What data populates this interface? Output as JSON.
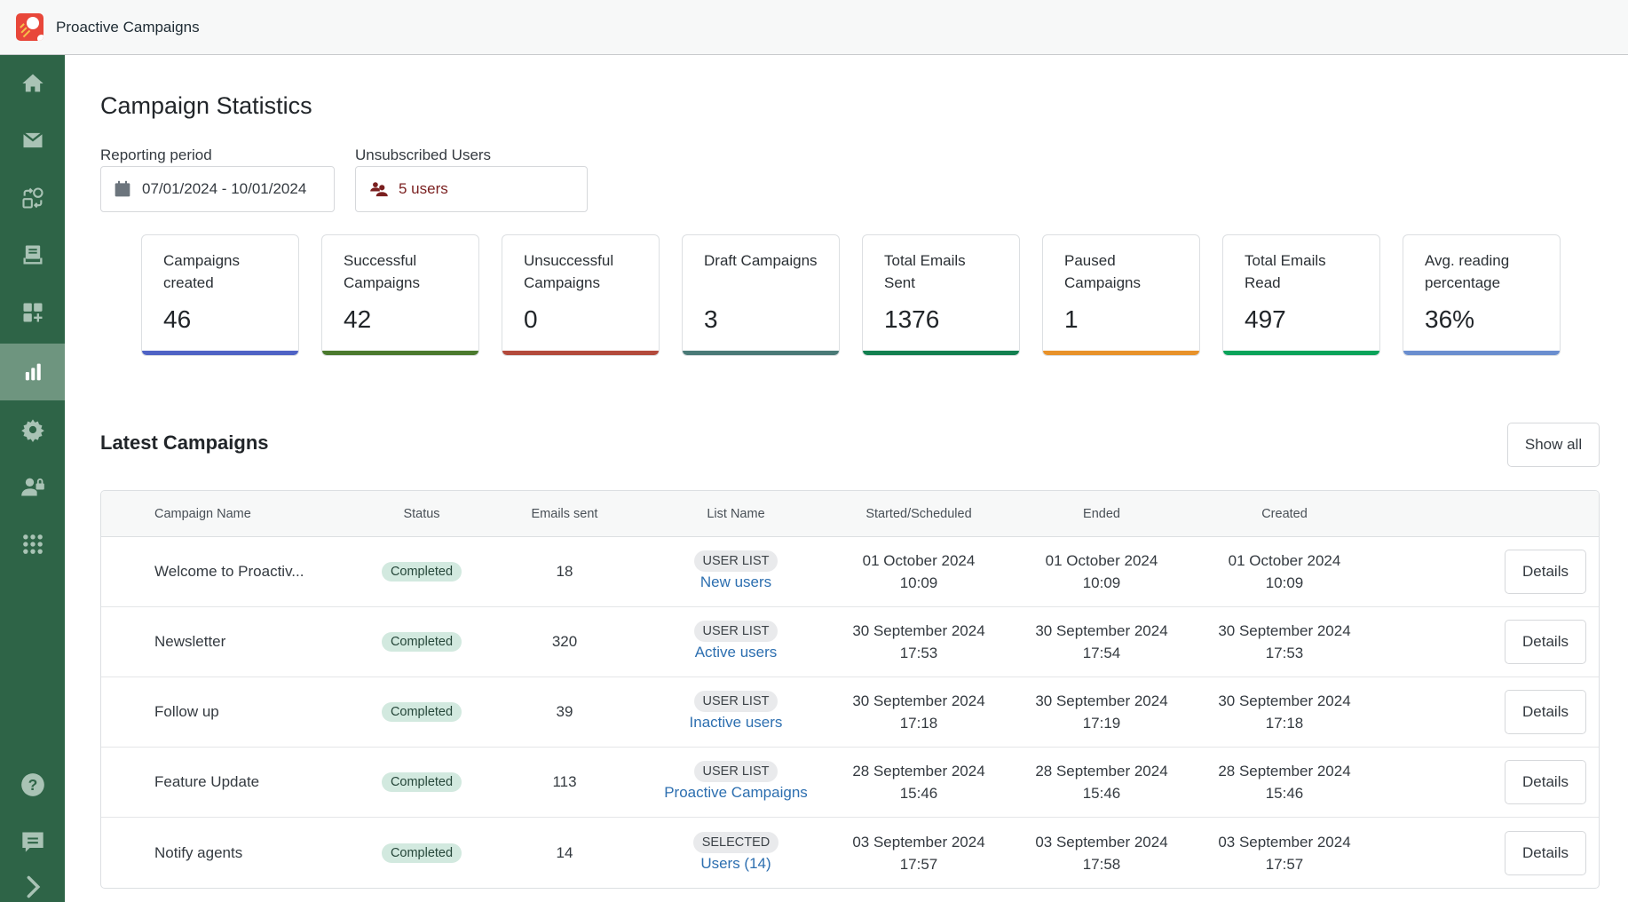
{
  "app": {
    "title": "Proactive Campaigns"
  },
  "sidebar": {
    "items": [
      {
        "name": "home",
        "icon": "home-icon",
        "active": false
      },
      {
        "name": "email",
        "icon": "envelope-icon",
        "active": false
      },
      {
        "name": "automations",
        "icon": "workflow-icon",
        "active": false
      },
      {
        "name": "templates",
        "icon": "inbox-icon",
        "active": false
      },
      {
        "name": "widgets",
        "icon": "add-widget-icon",
        "active": false
      },
      {
        "name": "statistics",
        "icon": "bar-chart-icon",
        "active": true
      },
      {
        "name": "settings",
        "icon": "gear-icon",
        "active": false
      },
      {
        "name": "permissions",
        "icon": "user-lock-icon",
        "active": false
      },
      {
        "name": "apps",
        "icon": "grid-icon",
        "active": false
      }
    ],
    "bottom": [
      {
        "name": "help",
        "icon": "help-icon"
      },
      {
        "name": "feedback",
        "icon": "chat-icon"
      },
      {
        "name": "expand",
        "icon": "chevron-right-icon"
      }
    ]
  },
  "page": {
    "title": "Campaign Statistics"
  },
  "filters": {
    "reporting_period": {
      "label": "Reporting period",
      "value": "07/01/2024 - 10/01/2024"
    },
    "unsubscribed": {
      "label": "Unsubscribed Users",
      "value": "5 users"
    }
  },
  "stats": [
    {
      "label": "Campaigns created",
      "value": "46",
      "color": "#4f63c5"
    },
    {
      "label": "Successful Campaigns",
      "value": "42",
      "color": "#4b7a2e"
    },
    {
      "label": "Unsuccessful Campaigns",
      "value": "0",
      "color": "#b34a3c"
    },
    {
      "label": "Draft Campaigns",
      "value": "3",
      "color": "#4a7a77"
    },
    {
      "label": "Total Emails Sent",
      "value": "1376",
      "color": "#138050"
    },
    {
      "label": "Paused Campaigns",
      "value": "1",
      "color": "#e8922a"
    },
    {
      "label": "Total Emails Read",
      "value": "497",
      "color": "#0aa35a"
    },
    {
      "label": "Avg. reading percentage",
      "value": "36%",
      "color": "#6a8ecf"
    }
  ],
  "latest": {
    "title": "Latest Campaigns",
    "show_all_label": "Show all",
    "columns": [
      "Campaign Name",
      "Status",
      "Emails sent",
      "List Name",
      "Started/Scheduled",
      "Ended",
      "Created"
    ],
    "details_label": "Details",
    "rows": [
      {
        "name": "Welcome to Proactiv...",
        "status": "Completed",
        "sent": "18",
        "list_type": "USER LIST",
        "list_name": "New users",
        "start_date": "01 October 2024",
        "start_time": "10:09",
        "end_date": "01 October 2024",
        "end_time": "10:09",
        "created_date": "01 October 2024",
        "created_time": "10:09"
      },
      {
        "name": "Newsletter",
        "status": "Completed",
        "sent": "320",
        "list_type": "USER LIST",
        "list_name": "Active users",
        "start_date": "30 September 2024",
        "start_time": "17:53",
        "end_date": "30 September 2024",
        "end_time": "17:54",
        "created_date": "30 September 2024",
        "created_time": "17:53"
      },
      {
        "name": "Follow up",
        "status": "Completed",
        "sent": "39",
        "list_type": "USER LIST",
        "list_name": "Inactive users",
        "start_date": "30 September 2024",
        "start_time": "17:18",
        "end_date": "30 September 2024",
        "end_time": "17:19",
        "created_date": "30 September 2024",
        "created_time": "17:18"
      },
      {
        "name": "Feature Update",
        "status": "Completed",
        "sent": "113",
        "list_type": "USER LIST",
        "list_name": "Proactive Campaigns",
        "start_date": "28 September 2024",
        "start_time": "15:46",
        "end_date": "28 September 2024",
        "end_time": "15:46",
        "created_date": "28 September 2024",
        "created_time": "15:46"
      },
      {
        "name": "Notify agents",
        "status": "Completed",
        "sent": "14",
        "list_type": "SELECTED",
        "list_name": "Users (14)",
        "start_date": "03 September 2024",
        "start_time": "17:57",
        "end_date": "03 September 2024",
        "end_time": "17:58",
        "created_date": "03 September 2024",
        "created_time": "17:57"
      }
    ]
  },
  "colors": {
    "sidebar": "#2e6447",
    "sidebar_active": "#6e957f",
    "icon": "#a9c3b5",
    "link": "#2d6fb0",
    "unsub": "#7a1f1f"
  }
}
